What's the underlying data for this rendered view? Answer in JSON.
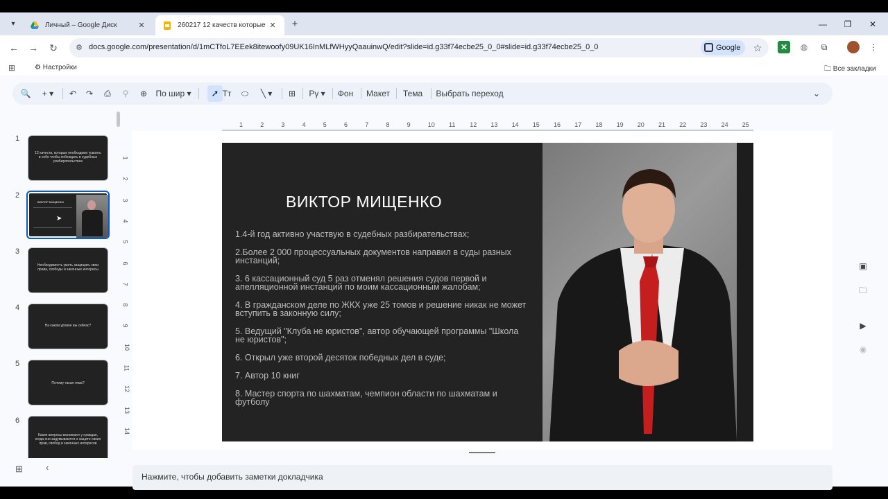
{
  "browser": {
    "tabs": [
      {
        "title": "Личный – Google Диск"
      },
      {
        "title": "260217 12 качеств которые не"
      }
    ],
    "url": "docs.google.com/presentation/d/1mCTfoL7EEek8itewoofy09UK16InMLfWHyyQaauinwQ/edit?slide=id.g33f74ecbe25_0_0#slide=id.g33f74ecbe25_0_0",
    "profile_pill": "Google",
    "bookmarks": {
      "left": "Настройки",
      "right": "Все закладки"
    }
  },
  "slides_toolbar": {
    "zoom": "По шир",
    "background": "Фон",
    "layout": "Макет",
    "theme": "Тема",
    "transition": "Выбрать переход"
  },
  "ruler": {
    "top": [
      "1",
      "2",
      "3",
      "4",
      "5",
      "6",
      "7",
      "8",
      "9",
      "10",
      "11",
      "12",
      "13",
      "14",
      "15",
      "16",
      "17",
      "18",
      "19",
      "20",
      "21",
      "22",
      "23",
      "24",
      "25"
    ],
    "left": [
      "1",
      "2",
      "3",
      "4",
      "5",
      "6",
      "7",
      "8",
      "9",
      "10",
      "11",
      "12",
      "13",
      "14"
    ]
  },
  "filmstrip": [
    {
      "num": "1",
      "text": "12 качеств, которые необходимо усвоить в себе чтобы побеждать в судебных разбирательствах"
    },
    {
      "num": "2",
      "text": "ВИКТОР МИЩЕНКО"
    },
    {
      "num": "3",
      "text": "Необходимость уметь защищать свои права, свободы и законные интересы"
    },
    {
      "num": "4",
      "text": "На каком уровне вы сейчас?"
    },
    {
      "num": "5",
      "text": "Почему такая тема?"
    },
    {
      "num": "6",
      "text": "Какие вопросы возникают у граждан, когда они задумываются о защите своих прав, свобод и законных интересов"
    }
  ],
  "slide": {
    "title": "ВИКТОР МИЩЕНКО",
    "points": [
      "1.4-й год активно участвую в судебных разбирательствах;",
      "2.Более 2 000 процессуальных документов направил в суды разных инстанций;",
      "3. 6 кассационный суд 5 раз отменял решения судов первой и апелляционной инстанций по моим кассационным жалобам;",
      "4. В гражданском деле по ЖКХ уже 25 томов и решение никак не может вступить в законную силу;",
      "5. Ведущий \"Клуба не юристов\", автор обучающей программы \"Школа не юристов\";",
      "6. Открыл уже второй десяток победных дел в суде;",
      "7. Автор 10 книг",
      "8. Мастер спорта по шахматам, чемпион области по шахматам и футболу"
    ]
  },
  "notes_placeholder": "Нажмите, чтобы добавить заметки докладчика"
}
